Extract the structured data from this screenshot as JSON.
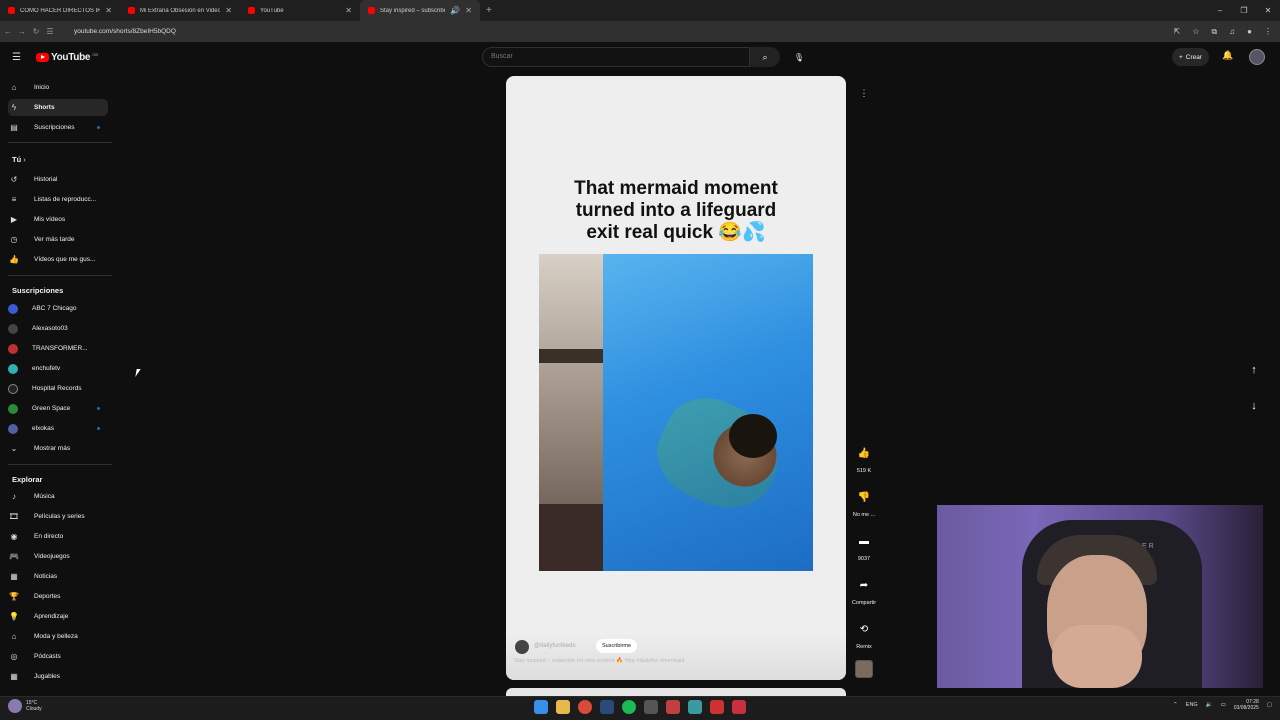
{
  "browser": {
    "tabs": [
      {
        "title": "COMO HACER DIRECTOS IRL",
        "active": false
      },
      {
        "title": "Mi Extraña Obsesión en Videoj",
        "active": false
      },
      {
        "title": "YouTube",
        "active": false
      },
      {
        "title": "Stay inspired – subscribe fo",
        "active": true
      }
    ],
    "url": "youtube.com/shorts/8ZbeIH5bQDQ"
  },
  "header": {
    "logo_text": "YouTube",
    "logo_cc": "GB",
    "search_placeholder": "Buscar",
    "create_label": "Crear"
  },
  "sidebar": {
    "main": [
      {
        "label": "Inicio",
        "icon": "home-icon"
      },
      {
        "label": "Shorts",
        "icon": "shorts-icon",
        "active": true
      },
      {
        "label": "Suscripciones",
        "icon": "subscriptions-icon"
      }
    ],
    "you_heading": "Tú",
    "you": [
      {
        "label": "Historial",
        "icon": "history-icon"
      },
      {
        "label": "Listas de reproducc...",
        "icon": "playlist-icon"
      },
      {
        "label": "Mis vídeos",
        "icon": "my-videos-icon"
      },
      {
        "label": "Ver más tarde",
        "icon": "clock-icon"
      },
      {
        "label": "Vídeos que me gus...",
        "icon": "thumb-up-icon"
      }
    ],
    "subs_heading": "Suscripciones",
    "subscriptions": [
      {
        "label": "ABC 7 Chicago",
        "color": "#3b5bd6"
      },
      {
        "label": "Alexasoto03",
        "color": "#444444"
      },
      {
        "label": "TRANSFORMER...",
        "color": "#c03030"
      },
      {
        "label": "enchufetv",
        "color": "#30b0b0"
      },
      {
        "label": "Hospital Records",
        "color": "#222222"
      },
      {
        "label": "Green Space",
        "color": "#2a8a3a"
      },
      {
        "label": "elxokas",
        "color": "#5060a0"
      },
      {
        "label": "Mostrar más",
        "color": ""
      }
    ],
    "explore_heading": "Explorar",
    "explore": [
      {
        "label": "Música",
        "icon": "music-icon"
      },
      {
        "label": "Películas y series",
        "icon": "film-icon"
      },
      {
        "label": "En directo",
        "icon": "live-icon"
      },
      {
        "label": "Videojuegos",
        "icon": "gamepad-icon"
      },
      {
        "label": "Noticias",
        "icon": "news-icon"
      },
      {
        "label": "Deportes",
        "icon": "trophy-icon"
      },
      {
        "label": "Aprendizaje",
        "icon": "lightbulb-icon"
      },
      {
        "label": "Moda y belleza",
        "icon": "hanger-icon"
      },
      {
        "label": "Pódcasts",
        "icon": "podcast-icon"
      },
      {
        "label": "Jugables",
        "icon": "grid-icon"
      }
    ]
  },
  "short": {
    "caption": "That mermaid moment turned into a lifeguard exit real quick 😂💦",
    "channel": "@dailyfunfeeds",
    "subscribe_label": "Suscribirme",
    "description": "Stay inspired – subscribe for new content 🔥 #fyp #dailyfun #mermaid"
  },
  "actions": {
    "likes": "519 K",
    "dislike_label": "No me ...",
    "comments": "9037",
    "share_label": "Compartir",
    "remix_label": "Remix"
  },
  "webcam": {
    "brand_text": "RAZER"
  },
  "taskbar": {
    "temp": "15°C",
    "weather": "Cloudy",
    "lang": "ENG",
    "time": "07:28",
    "date": "03/08/2025"
  }
}
